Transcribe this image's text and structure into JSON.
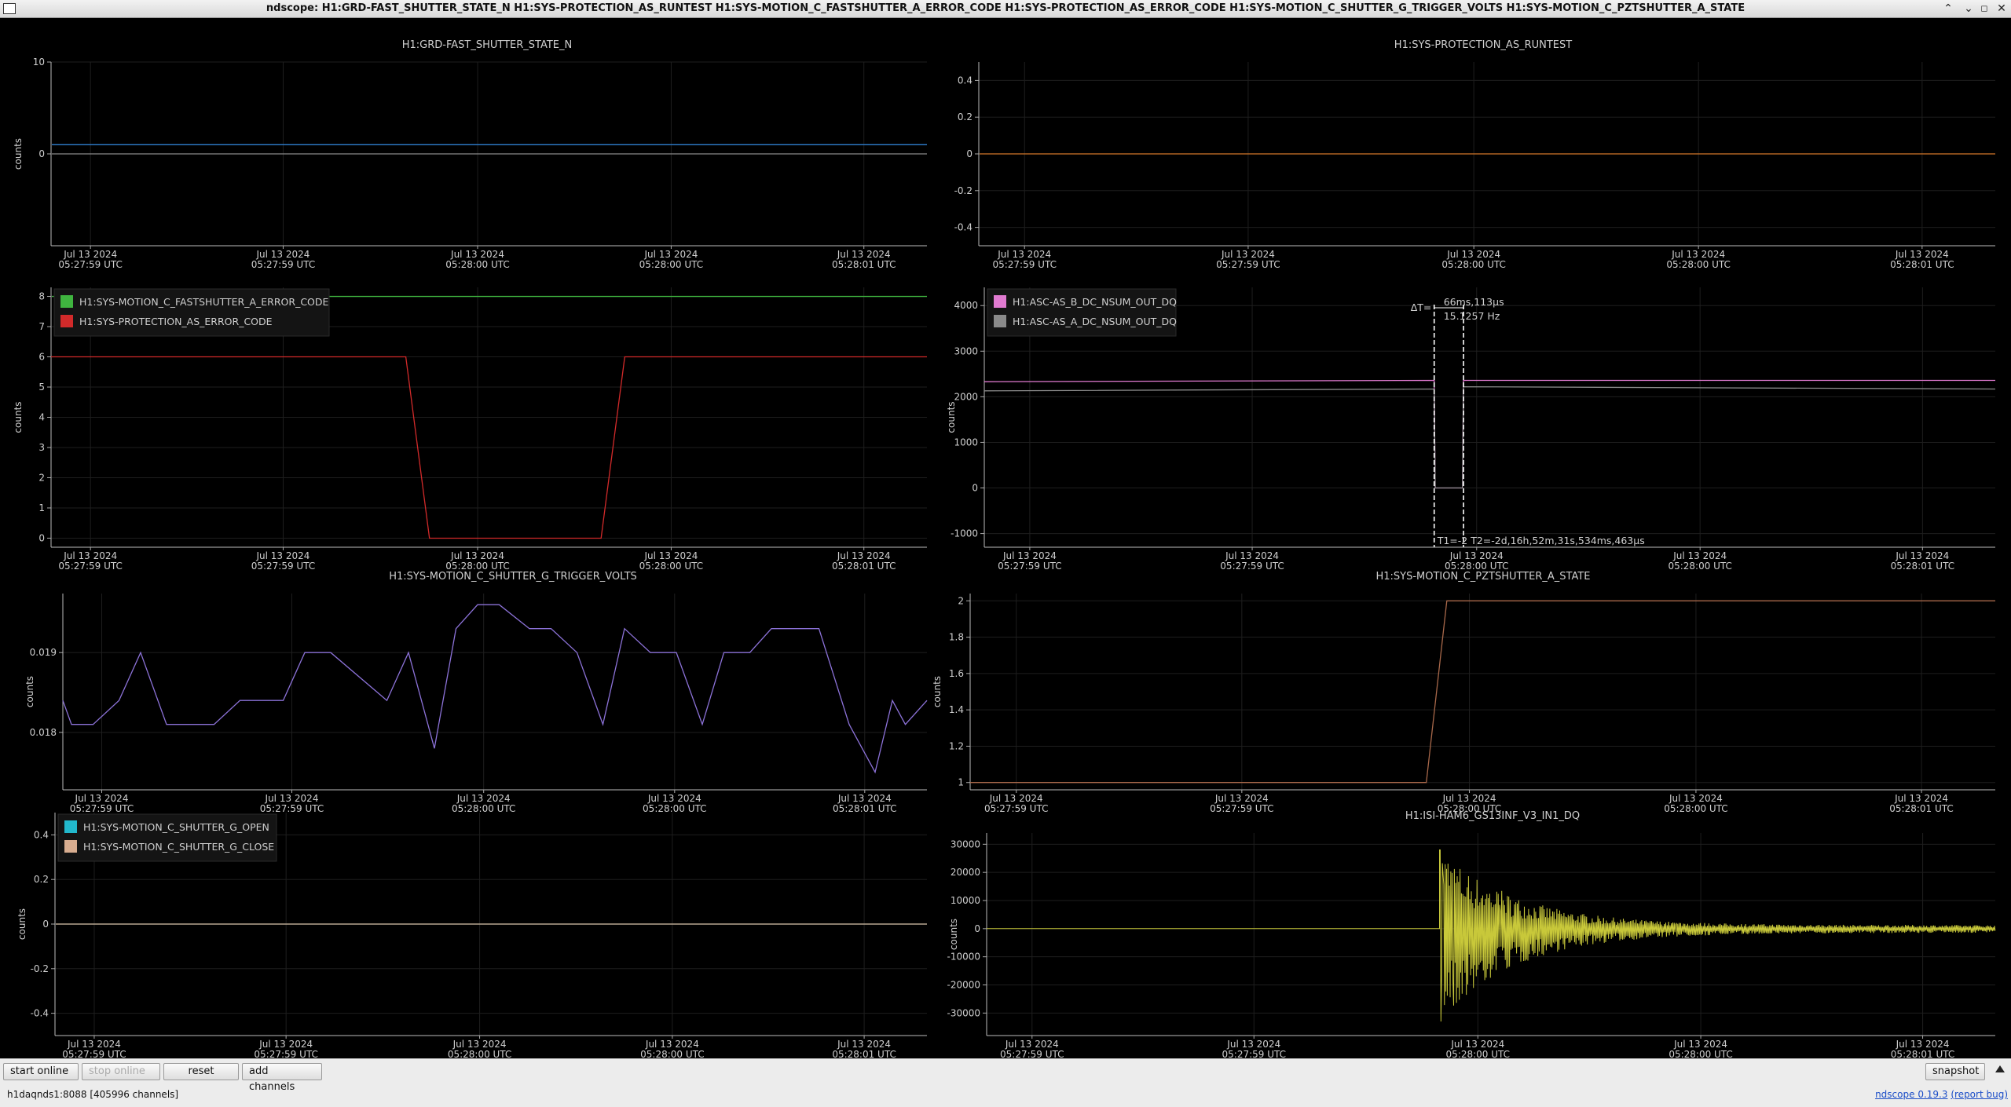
{
  "window": {
    "title": "ndscope: H1:GRD-FAST_SHUTTER_STATE_N H1:SYS-PROTECTION_AS_RUNTEST H1:SYS-MOTION_C_FASTSHUTTER_A_ERROR_CODE H1:SYS-PROTECTION_AS_ERROR_CODE H1:SYS-MOTION_C_SHUTTER_G_TRIGGER_VOLTS H1:SYS-MOTION_C_PZTSHUTTER_A_STATE",
    "controls": [
      "minimize-icon",
      "maximize-icon",
      "restore-icon",
      "close-icon"
    ]
  },
  "time_ticks": [
    [
      "Jul 13 2024",
      "05:27:59 UTC"
    ],
    [
      "Jul 13 2024",
      "05:27:59 UTC"
    ],
    [
      "Jul 13 2024",
      "05:28:00 UTC"
    ],
    [
      "Jul 13 2024",
      "05:28:00 UTC"
    ],
    [
      "Jul 13 2024",
      "05:28:01 UTC"
    ]
  ],
  "colors": {
    "blue": "#2f7fd0",
    "orange": "#d2772a",
    "green": "#3fb53f",
    "red": "#d22a2a",
    "pink": "#e07ad0",
    "gray": "#8a8a8a",
    "purple": "#8c72d8",
    "brown": "#a8684a",
    "cyan": "#22b8cc",
    "tan": "#d8ad90",
    "yellow": "#c8c83a"
  },
  "plots": [
    {
      "id": "p1",
      "title": "H1:GRD-FAST_SHUTTER_STATE_N",
      "ylabel": "counts",
      "yticks": [
        "10",
        "0"
      ],
      "legend": [],
      "chart_data": {
        "type": "line",
        "ylim": [
          -10,
          10
        ],
        "series": [
          {
            "color": "blue",
            "y_const": 1
          },
          {
            "color": "gray",
            "y_const": 0
          }
        ]
      }
    },
    {
      "id": "p2",
      "title": "H1:SYS-PROTECTION_AS_RUNTEST",
      "ylabel": "",
      "yticks": [
        "0.4",
        "0.2",
        "0",
        "-0.2",
        "-0.4"
      ],
      "legend": [],
      "chart_data": {
        "type": "line",
        "ylim": [
          -0.5,
          0.5
        ],
        "series": [
          {
            "color": "orange",
            "y_const": 0
          }
        ]
      }
    },
    {
      "id": "p3",
      "title": "",
      "ylabel": "counts",
      "yticks": [
        "8",
        "7",
        "6",
        "5",
        "4",
        "3",
        "2",
        "1",
        "0"
      ],
      "legend": [
        {
          "label": "H1:SYS-MOTION_C_FASTSHUTTER_A_ERROR_CODE",
          "color": "green"
        },
        {
          "label": "H1:SYS-PROTECTION_AS_ERROR_CODE",
          "color": "red"
        }
      ],
      "chart_data": {
        "type": "line",
        "ylim": [
          -0.3,
          8.3
        ],
        "series": [
          {
            "name": "H1:SYS-MOTION_C_FASTSHUTTER_A_ERROR_CODE",
            "color": "green",
            "y_const": 8
          },
          {
            "name": "H1:SYS-PROTECTION_AS_ERROR_CODE",
            "color": "red",
            "x": [
              0,
              0.405,
              0.432,
              0.628,
              0.655,
              1
            ],
            "y": [
              6,
              6,
              0,
              0,
              6,
              6
            ]
          }
        ]
      }
    },
    {
      "id": "p4",
      "title": "",
      "ylabel": "counts",
      "yticks": [
        "4000",
        "3000",
        "2000",
        "1000",
        "0",
        "-1000"
      ],
      "legend": [
        {
          "label": "H1:ASC-AS_B_DC_NSUM_OUT_DQ",
          "color": "pink"
        },
        {
          "label": "H1:ASC-AS_A_DC_NSUM_OUT_DQ",
          "color": "gray"
        }
      ],
      "cursor": {
        "dt_label": "ΔT=",
        "dt_value": "66ms,113µs",
        "freq": "15.1257 Hz",
        "t_label": "T1=-2 T2=-2d,16h,52m,31s,534ms,463µs"
      },
      "chart_data": {
        "type": "line",
        "ylim": [
          -1300,
          4400
        ],
        "series": [
          {
            "name": "H1:ASC-AS_B_DC_NSUM_OUT_DQ",
            "color": "pink",
            "x": [
              0,
              0.445,
              0.446,
              0.473,
              0.474,
              1
            ],
            "y": [
              2330,
              2360,
              0,
              0,
              2360,
              2360
            ]
          },
          {
            "name": "H1:ASC-AS_A_DC_NSUM_OUT_DQ",
            "color": "gray",
            "x": [
              0,
              0.445,
              0.446,
              0.473,
              0.474,
              1
            ],
            "y": [
              2130,
              2170,
              0,
              0,
              2220,
              2170
            ]
          }
        ]
      }
    },
    {
      "id": "p5",
      "title": "H1:SYS-MOTION_C_SHUTTER_G_TRIGGER_VOLTS",
      "ylabel": "counts",
      "yticks": [
        "0.019",
        "0.018"
      ],
      "legend": [],
      "chart_data": {
        "type": "line",
        "ylim": [
          0.01728,
          0.01974
        ],
        "series": [
          {
            "color": "purple",
            "x": [
              0,
              0.01,
              0.035,
              0.065,
              0.09,
              0.12,
              0.145,
              0.175,
              0.205,
              0.255,
              0.28,
              0.31,
              0.375,
              0.4,
              0.43,
              0.455,
              0.48,
              0.505,
              0.54,
              0.565,
              0.595,
              0.625,
              0.65,
              0.68,
              0.71,
              0.74,
              0.765,
              0.795,
              0.82,
              0.85,
              0.875,
              0.91,
              0.94,
              0.96,
              0.975,
              1
            ],
            "y": [
              0.0184,
              0.0181,
              0.0181,
              0.0184,
              0.019,
              0.0181,
              0.0181,
              0.0181,
              0.0184,
              0.0184,
              0.019,
              0.019,
              0.0184,
              0.019,
              0.0178,
              0.0193,
              0.0196,
              0.0196,
              0.0193,
              0.0193,
              0.019,
              0.0181,
              0.0193,
              0.019,
              0.019,
              0.0181,
              0.019,
              0.019,
              0.0193,
              0.0193,
              0.0193,
              0.0181,
              0.0175,
              0.0184,
              0.0181,
              0.0184
            ]
          }
        ]
      }
    },
    {
      "id": "p6",
      "title": "H1:SYS-MOTION_C_PZTSHUTTER_A_STATE",
      "ylabel": "counts",
      "yticks": [
        "2",
        "1.8",
        "1.6",
        "1.4",
        "1.2",
        "1"
      ],
      "legend": [],
      "chart_data": {
        "type": "line",
        "ylim": [
          0.96,
          2.04
        ],
        "series": [
          {
            "color": "brown",
            "x": [
              0,
              0.445,
              0.465,
              1
            ],
            "y": [
              1,
              1,
              2,
              2
            ]
          }
        ]
      }
    },
    {
      "id": "p7",
      "title": "",
      "ylabel": "counts",
      "yticks": [
        "0.4",
        "0.2",
        "0",
        "-0.2",
        "-0.4"
      ],
      "legend": [
        {
          "label": "H1:SYS-MOTION_C_SHUTTER_G_OPEN",
          "color": "cyan"
        },
        {
          "label": "H1:SYS-MOTION_C_SHUTTER_G_CLOSE",
          "color": "tan"
        }
      ],
      "chart_data": {
        "type": "line",
        "ylim": [
          -0.5,
          0.5
        ],
        "series": [
          {
            "name": "H1:SYS-MOTION_C_SHUTTER_G_OPEN",
            "color": "cyan",
            "y_const": 0
          },
          {
            "name": "H1:SYS-MOTION_C_SHUTTER_G_CLOSE",
            "color": "tan",
            "y_const": 0
          }
        ]
      }
    },
    {
      "id": "p8",
      "title": "H1:ISI-HAM6_GS13INF_V3_IN1_DQ",
      "ylabel": "counts",
      "yticks": [
        "30000",
        "20000",
        "10000",
        "0",
        "-10000",
        "-20000",
        "-30000"
      ],
      "legend": [],
      "chart_data": {
        "type": "line",
        "ylim": [
          -38000,
          34000
        ],
        "series": [
          {
            "color": "yellow",
            "signal": "decaying_burst",
            "x_onset": 0.449,
            "peak": 28000,
            "trough": -33000,
            "baseline": 0
          }
        ]
      }
    }
  ],
  "toolbar": {
    "start_online": "start online",
    "stop_online": "stop online",
    "reset": "reset",
    "add_channels": "add channels",
    "snapshot": "snapshot"
  },
  "status": {
    "server": "h1daqnds1:8088",
    "channels": "[405996 channels]",
    "version_label": "ndscope",
    "version": "0.19.3",
    "report": "(report bug)"
  }
}
